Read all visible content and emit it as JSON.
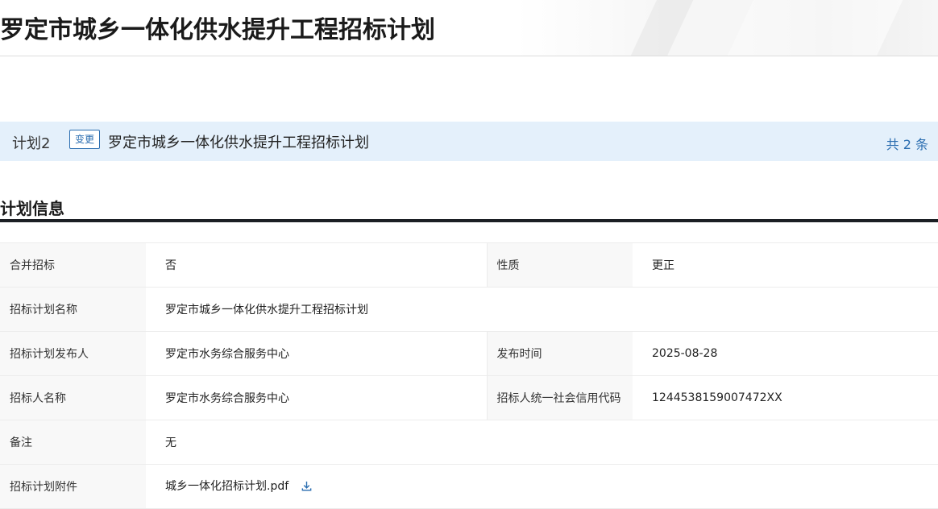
{
  "page": {
    "title": "罗定市城乡一体化供水提升工程招标计划"
  },
  "plan_bar": {
    "plan_no": "计划2",
    "tag": "变更",
    "name": "罗定市城乡一体化供水提升工程招标计划",
    "count": "共 2 条"
  },
  "section": {
    "title": "计划信息"
  },
  "info": {
    "merge_label": "合并招标",
    "merge_value": "否",
    "nature_label": "性质",
    "nature_value": "更正",
    "plan_name_label": "招标计划名称",
    "plan_name_value": "罗定市城乡一体化供水提升工程招标计划",
    "publisher_label": "招标计划发布人",
    "publisher_value": "罗定市水务综合服务中心",
    "publish_time_label": "发布时间",
    "publish_time_value": "2025-08-28",
    "tenderer_label": "招标人名称",
    "tenderer_value": "罗定市水务综合服务中心",
    "credit_code_label": "招标人统一社会信用代码",
    "credit_code_value": "1244538159007472XX",
    "remark_label": "备注",
    "remark_value": "无",
    "attachment_label": "招标计划附件",
    "attachment_value": "城乡一体化招标计划.pdf"
  },
  "icons": {
    "download": "download-icon"
  },
  "colors": {
    "accent": "#2a6db0",
    "bar_bg": "#e4f0fb",
    "label_bg": "#f8f8f8",
    "section_rule": "#1b1f24"
  }
}
